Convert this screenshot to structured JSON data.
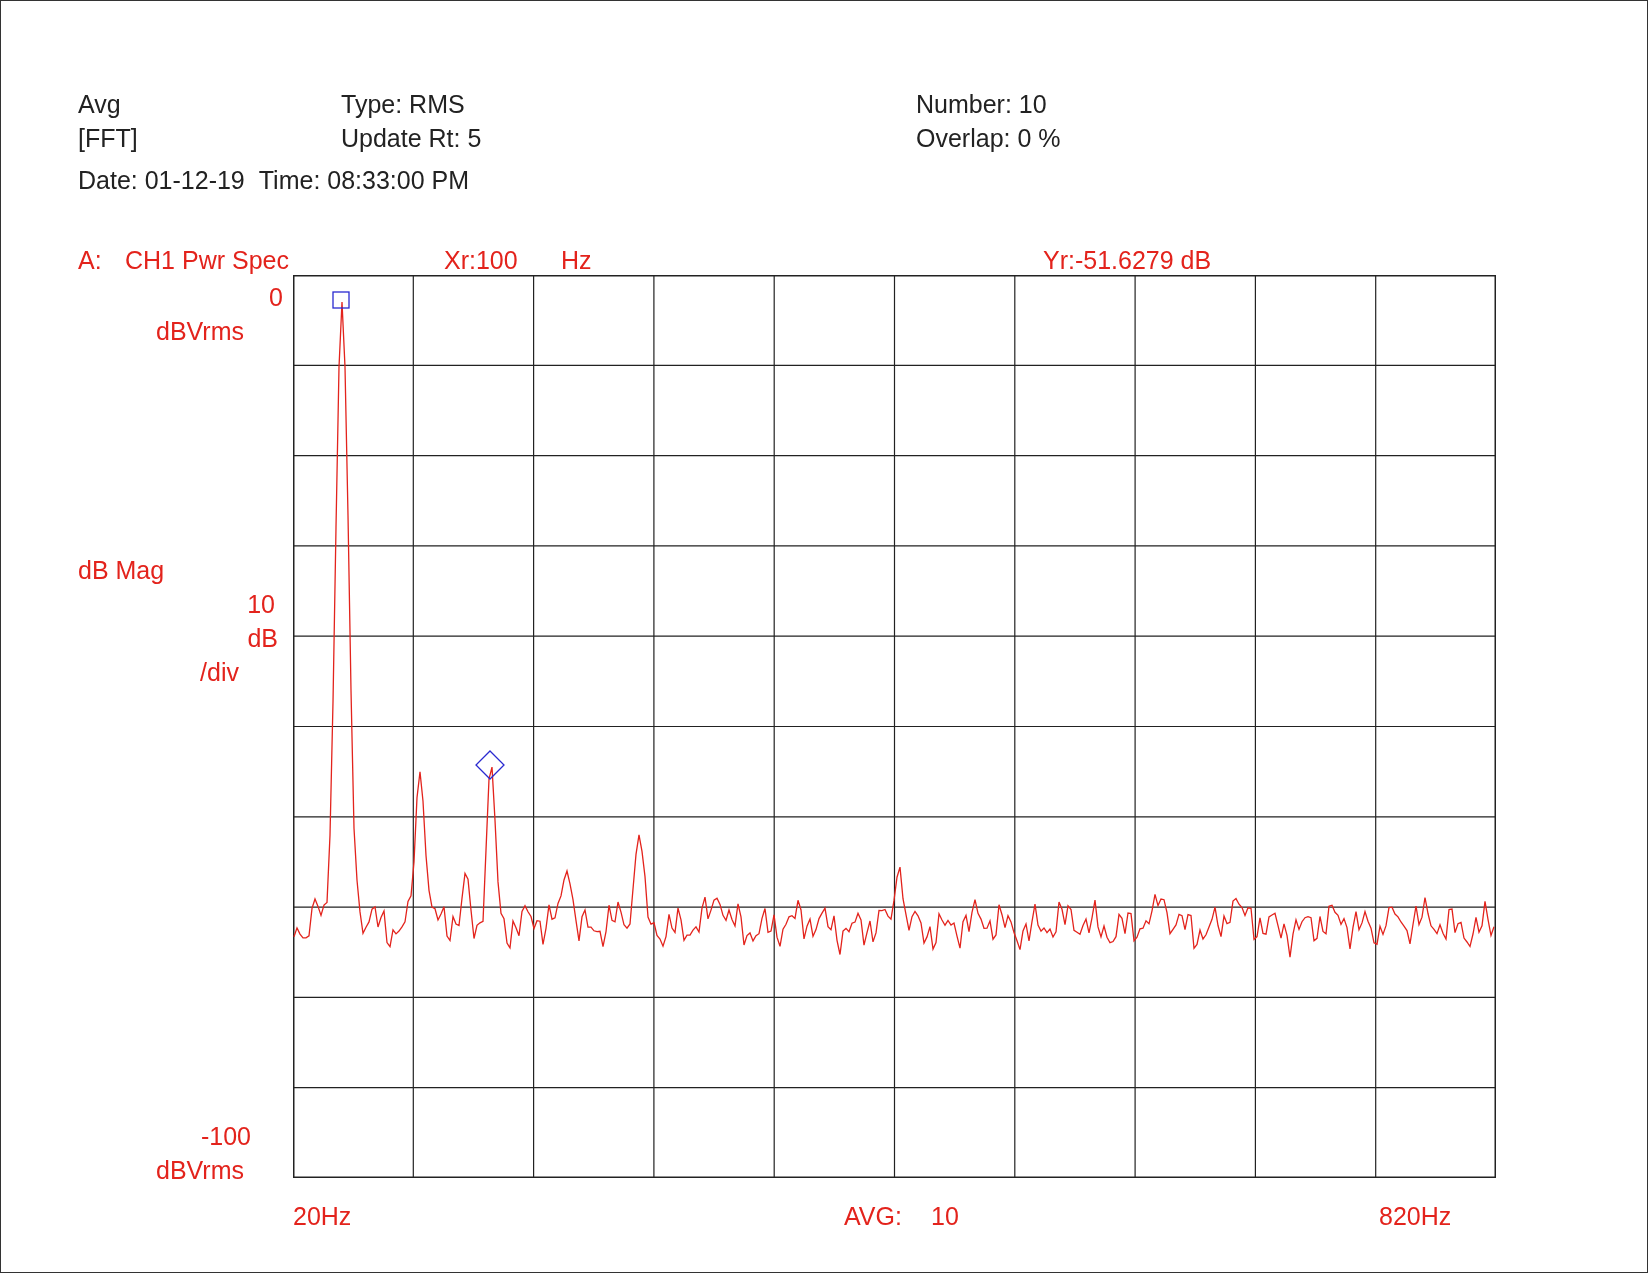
{
  "header": {
    "mode": "Avg",
    "type": "Type: RMS",
    "number": "Number: 10",
    "domain": "[FFT]",
    "update_rate": "Update Rt: 5",
    "overlap": "Overlap: 0 %",
    "date": "Date: 01-12-19",
    "time": "Time: 08:33:00 PM"
  },
  "trace_header": {
    "trace": "A:",
    "measurement": "CH1 Pwr Spec",
    "x_readout": "Xr:100",
    "x_unit": "Hz",
    "y_readout": "Yr:-51.6279 dB"
  },
  "y_axis": {
    "top_value": "0",
    "top_unit": "dBVrms",
    "label": "dB Mag",
    "scale": "10",
    "scale_unit": "dB",
    "scale_per": "/div",
    "bottom_value": "-100",
    "bottom_unit": "dBVrms"
  },
  "x_axis": {
    "start": "20Hz",
    "average_label": "AVG:",
    "average_count": "10",
    "stop": "820Hz"
  }
}
